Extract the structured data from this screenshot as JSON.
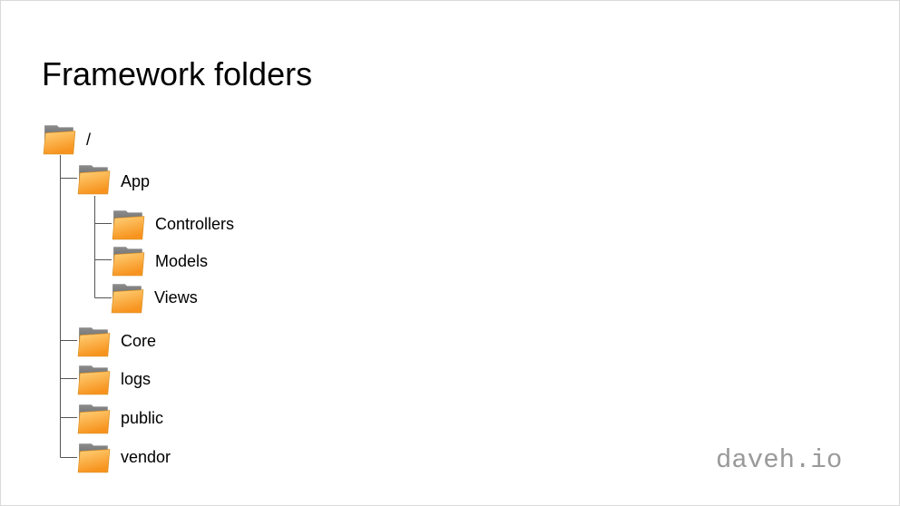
{
  "slide": {
    "title": "Framework folders",
    "watermark": "daveh.io"
  },
  "colors": {
    "folder_front_light": "#ffd27a",
    "folder_front_dark": "#f7931e",
    "folder_back_light": "#8c8c8c",
    "folder_back_dark": "#4d4d4d",
    "tree_line": "#555555"
  },
  "tree": {
    "root": {
      "label": "/",
      "icon": "folder-icon"
    },
    "children": [
      {
        "label": "App",
        "icon": "folder-icon",
        "children": [
          {
            "label": "Controllers",
            "icon": "folder-icon"
          },
          {
            "label": "Models",
            "icon": "folder-icon"
          },
          {
            "label": "Views",
            "icon": "folder-icon"
          }
        ]
      },
      {
        "label": "Core",
        "icon": "folder-icon"
      },
      {
        "label": "logs",
        "icon": "folder-icon"
      },
      {
        "label": "public",
        "icon": "folder-icon"
      },
      {
        "label": "vendor",
        "icon": "folder-icon"
      }
    ]
  }
}
